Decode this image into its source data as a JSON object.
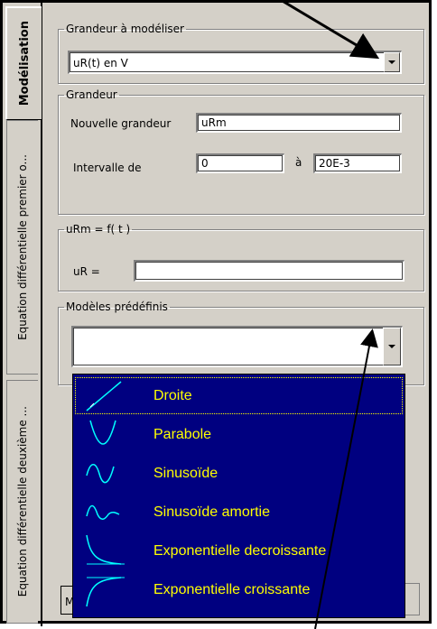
{
  "tabs": [
    {
      "label": "Modélisation",
      "active": true
    },
    {
      "label": "Equation différentielle premier o...",
      "active": false
    },
    {
      "label": "Equation différentielle deuxième ...",
      "active": false
    }
  ],
  "grandeur_a_modeliser": {
    "legend": "Grandeur à modéliser",
    "value": "uR(t) en V"
  },
  "grandeur": {
    "legend": "Grandeur",
    "nouvelle_label": "Nouvelle grandeur",
    "nouvelle_value": "uRm",
    "intervalle_label": "Intervalle de",
    "from_value": "0",
    "a_label": "à",
    "to_value": "20E-3"
  },
  "formula": {
    "legend": "uRm = f( t )",
    "label": "uR =",
    "value": ""
  },
  "modeles": {
    "legend": "Modèles prédéfinis",
    "value": "",
    "options": [
      {
        "label": "Droite",
        "icon": "line-icon",
        "selected": true
      },
      {
        "label": "Parabole",
        "icon": "parabola-icon"
      },
      {
        "label": "Sinusoïde",
        "icon": "sine-icon"
      },
      {
        "label": "Sinusoïde amortie",
        "icon": "damped-sine-icon"
      },
      {
        "label": "Exponentielle decroissante",
        "icon": "exp-decay-icon"
      },
      {
        "label": "Exponentielle croissante",
        "icon": "exp-growth-icon"
      }
    ]
  },
  "bottom_button_label": "M",
  "colors": {
    "dropdown_bg": "#000080",
    "dropdown_text": "#ffff00",
    "icon_curve": "#00ffff"
  }
}
